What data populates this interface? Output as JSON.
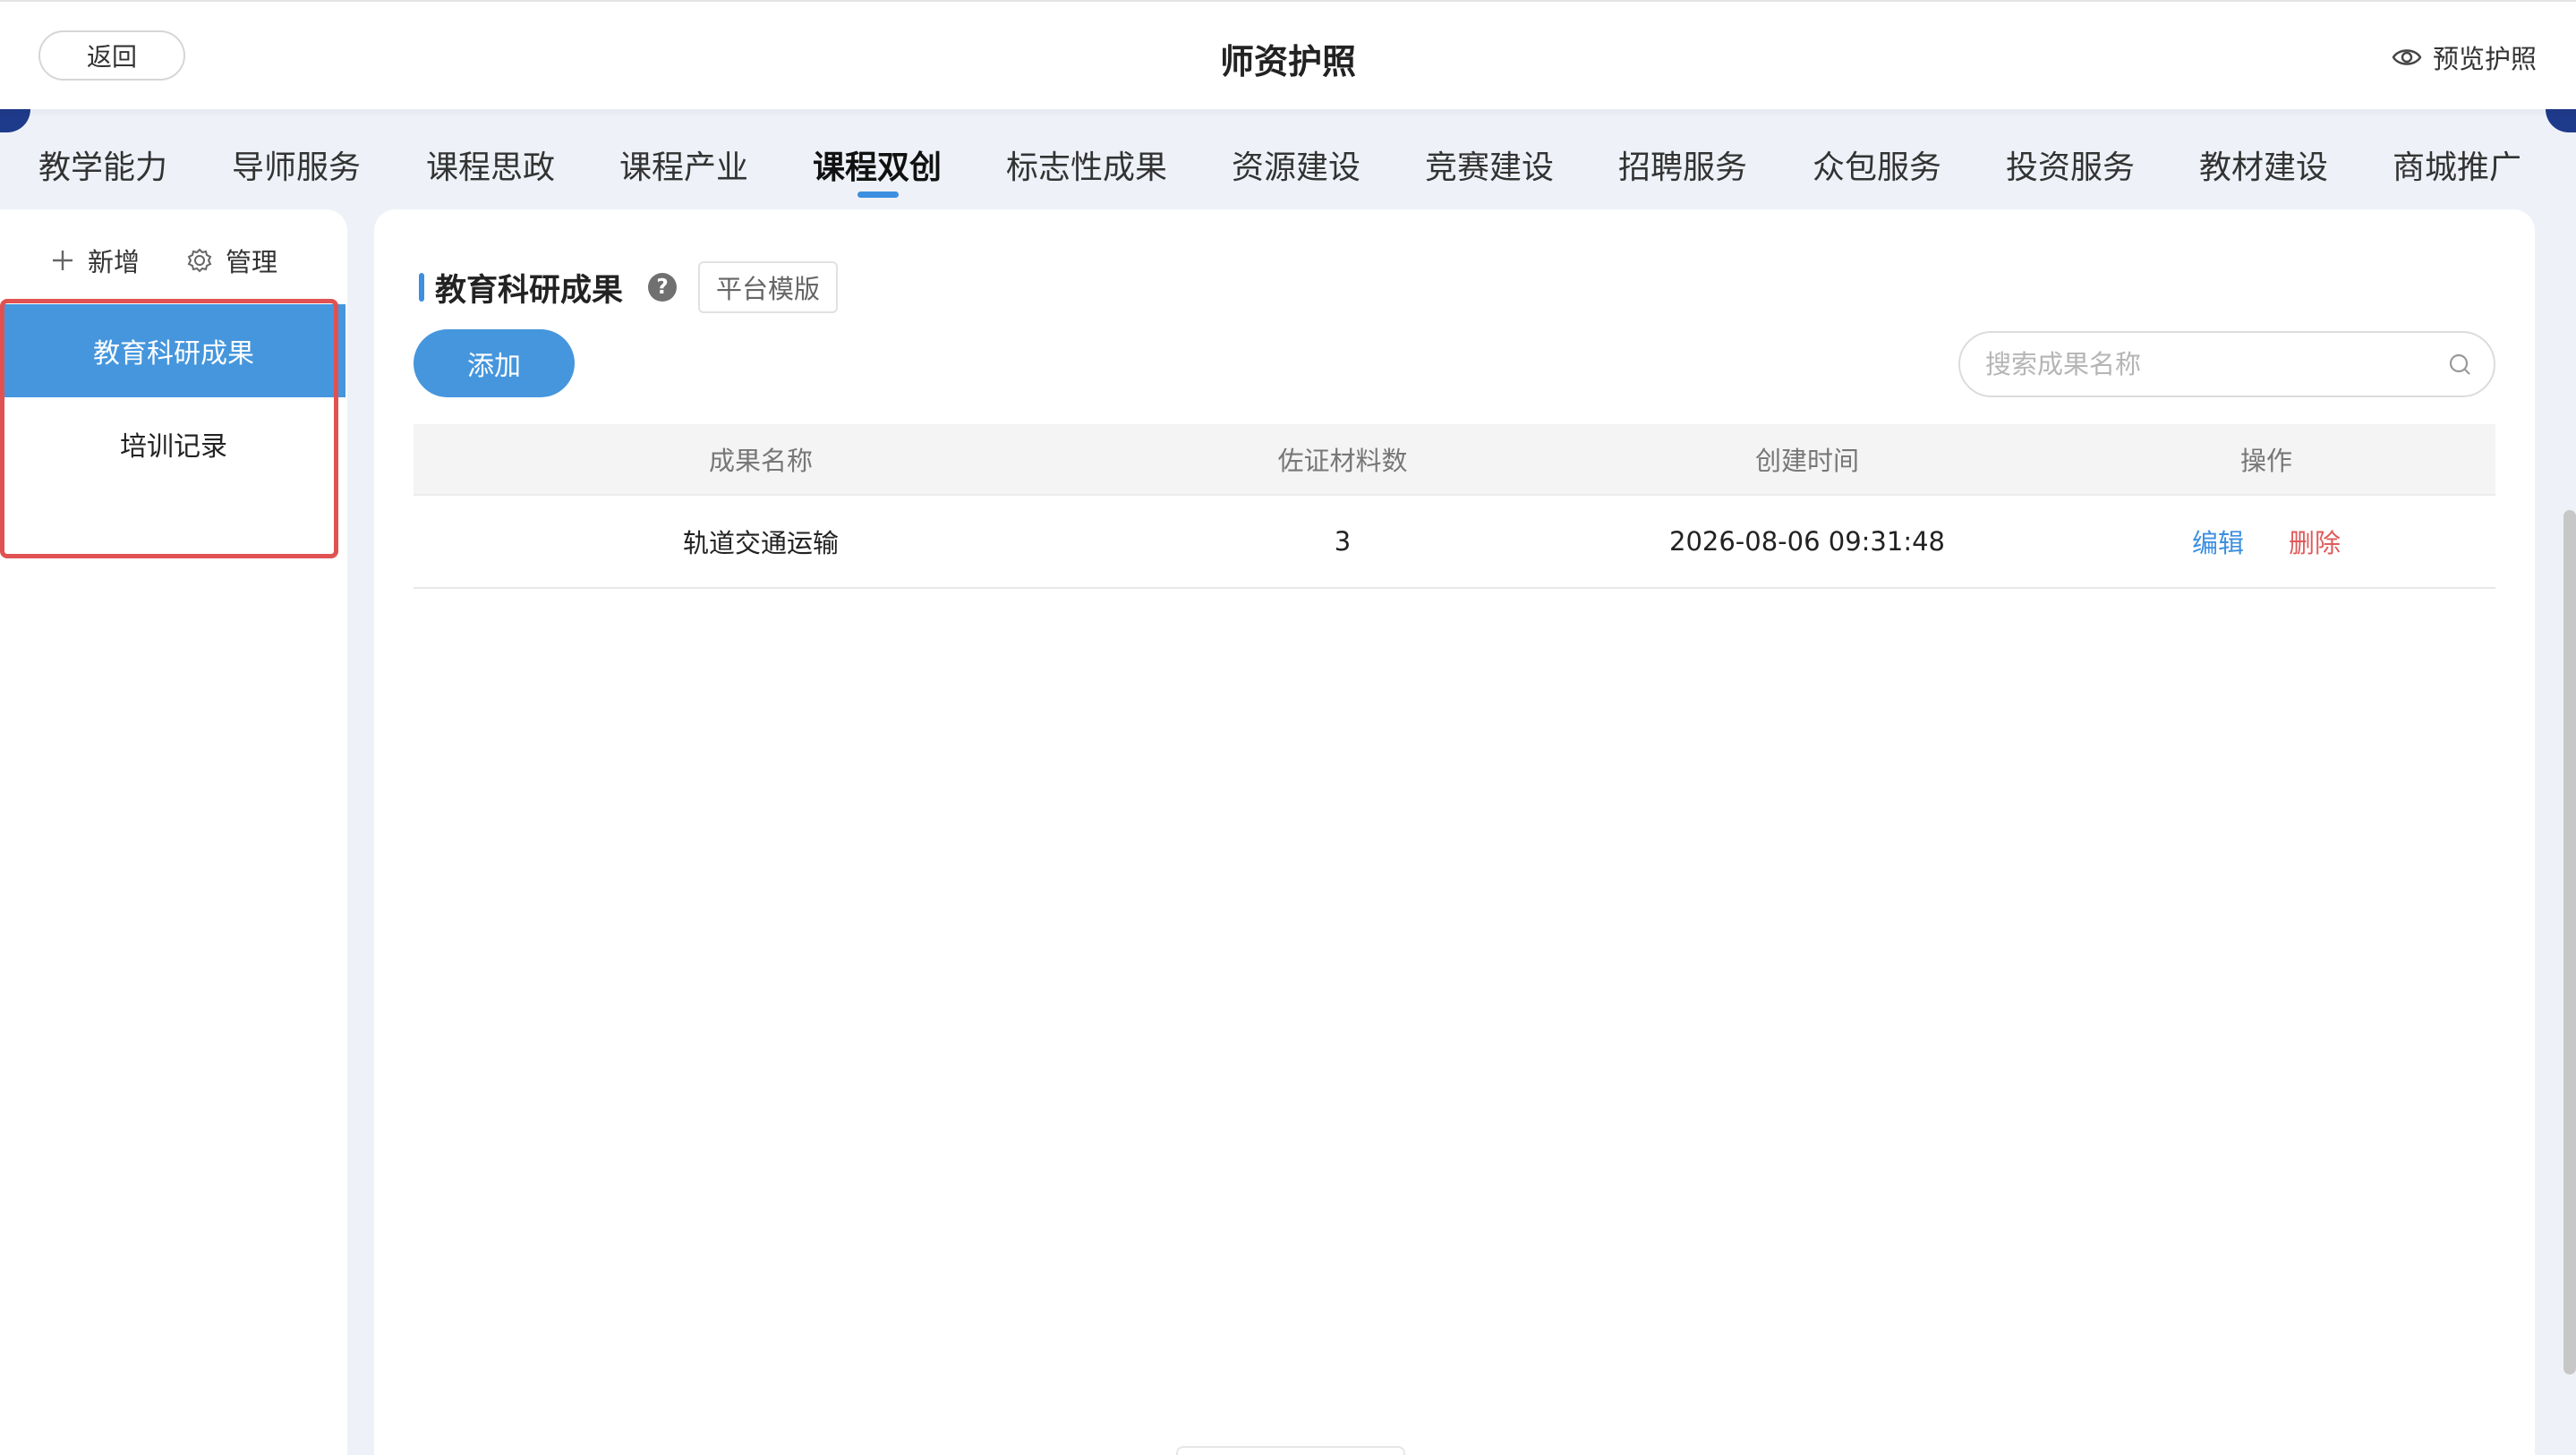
{
  "header": {
    "back_label": "返回",
    "title": "师资护照",
    "preview_label": "预览护照"
  },
  "tabs": [
    {
      "label": "教学能力"
    },
    {
      "label": "导师服务"
    },
    {
      "label": "课程思政"
    },
    {
      "label": "课程产业"
    },
    {
      "label": "课程双创",
      "active": true
    },
    {
      "label": "标志性成果"
    },
    {
      "label": "资源建设"
    },
    {
      "label": "竞赛建设"
    },
    {
      "label": "招聘服务"
    },
    {
      "label": "众包服务"
    },
    {
      "label": "投资服务"
    },
    {
      "label": "教材建设"
    },
    {
      "label": "商城推广"
    }
  ],
  "sidebar": {
    "add_label": "新增",
    "manage_label": "管理",
    "items": [
      {
        "label": "教育科研成果",
        "active": true
      },
      {
        "label": "培训记录"
      }
    ]
  },
  "main": {
    "section_title": "教育科研成果",
    "help_icon": "?",
    "template_tag": "平台模版",
    "add_button": "添加",
    "search_placeholder": "搜索成果名称",
    "table": {
      "headers": [
        "成果名称",
        "佐证材料数",
        "创建时间",
        "操作"
      ],
      "rows": [
        {
          "name": "轨道交通运输",
          "count": "3",
          "created": "2026-08-06 09:31:48",
          "edit": "编辑",
          "delete": "删除"
        }
      ]
    }
  },
  "colors": {
    "accent": "#4596dd",
    "danger": "#e05a5a",
    "highlight_box": "#e05252"
  }
}
